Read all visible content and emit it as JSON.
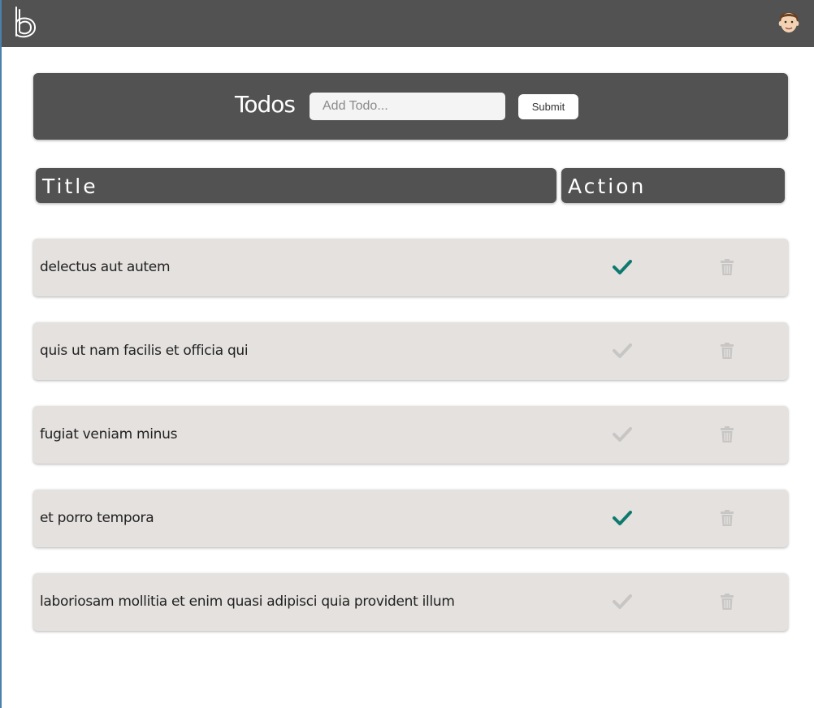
{
  "header": {
    "title": "Todos",
    "input_placeholder": "Add Todo...",
    "input_value": "",
    "submit_label": "Submit"
  },
  "columns": {
    "title": "Title",
    "action": "Action"
  },
  "todos": [
    {
      "title": "delectus aut autem",
      "completed": true
    },
    {
      "title": "quis ut nam facilis et officia qui",
      "completed": false
    },
    {
      "title": "fugiat veniam minus",
      "completed": false
    },
    {
      "title": "et porro tempora",
      "completed": true
    },
    {
      "title": "laboriosam mollitia et enim quasi adipisci quia provident illum",
      "completed": false
    }
  ],
  "icons": {
    "logo": "brand-b-logo-icon",
    "avatar": "user-avatar-icon",
    "complete": "check-icon",
    "delete": "trash-icon"
  },
  "colors": {
    "navbar": "#525252",
    "row_background": "#e4e1df",
    "check_active": "#0e7a6e",
    "check_inactive": "#c8c6c4",
    "trash": "#c8c6c4"
  }
}
